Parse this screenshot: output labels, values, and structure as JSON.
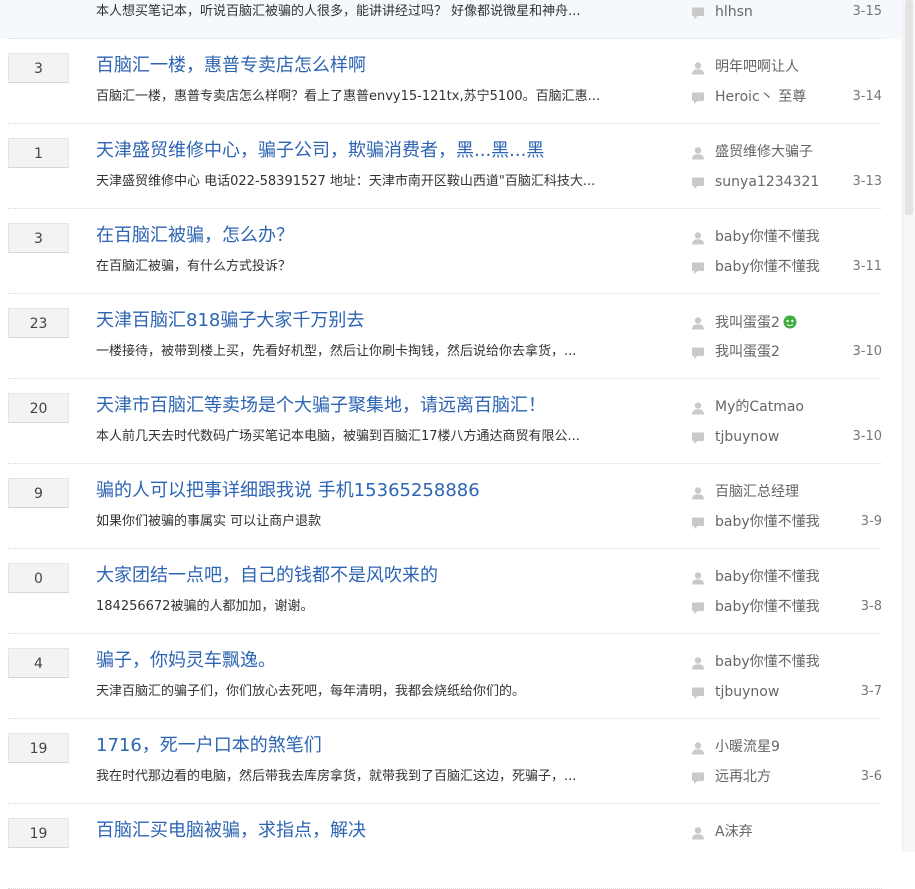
{
  "threads": [
    {
      "replies": "",
      "title": "",
      "excerpt": "本人想买笔记本，听说百脑汇被骗的人很多，能讲讲经过吗？ 好像都说微星和神舟...",
      "author": "",
      "last_replier": "hlhsn",
      "date": "3-15"
    },
    {
      "replies": "3",
      "title": "百脑汇一楼，惠普专卖店怎么样啊",
      "excerpt": "百脑汇一楼，惠普专卖店怎么样啊？看上了惠普envy15-121tx,苏宁5100。百脑汇惠...",
      "author": "明年吧啊让人",
      "last_replier": "Heroic丶 至尊",
      "date": "3-14"
    },
    {
      "replies": "1",
      "title": "天津盛贸维修中心，骗子公司，欺骗消费者，黑...黑...黑",
      "excerpt": "天津盛贸维修中心 电话022-58391527 地址：天津市南开区鞍山西道\"百脑汇科技大...",
      "author": "盛贸维修大骗子",
      "last_replier": "sunya1234321",
      "date": "3-13"
    },
    {
      "replies": "3",
      "title": "在百脑汇被骗，怎么办？",
      "excerpt": "在百脑汇被骗，有什么方式投诉？",
      "author": "baby你懂不懂我",
      "last_replier": "baby你懂不懂我",
      "date": "3-11"
    },
    {
      "replies": "23",
      "title": "天津百脑汇818骗子大家千万别去",
      "excerpt": "一楼接待，被带到楼上买，先看好机型，然后让你刷卡掏钱，然后说给你去拿货，...",
      "author": "我叫蛋蛋2",
      "author_badge": "green-face-icon",
      "last_replier": "我叫蛋蛋2",
      "date": "3-10"
    },
    {
      "replies": "20",
      "title": "天津市百脑汇等卖场是个大骗子聚集地，请远离百脑汇！",
      "excerpt": "本人前几天去时代数码广场买笔记本电脑，被骗到百脑汇17楼八方通达商贸有限公...",
      "author": "My的Catmao",
      "last_replier": "tjbuynow",
      "date": "3-10"
    },
    {
      "replies": "9",
      "title": "骗的人可以把事详细跟我说 手机15365258886",
      "excerpt": "如果你们被骗的事属实 可以让商户退款",
      "author": "百脑汇总经理",
      "last_replier": "baby你懂不懂我",
      "date": "3-9"
    },
    {
      "replies": "0",
      "title": "大家团结一点吧，自己的钱都不是风吹来的",
      "excerpt": "184256672被骗的人都加加，谢谢。",
      "author": "baby你懂不懂我",
      "last_replier": "baby你懂不懂我",
      "date": "3-8"
    },
    {
      "replies": "4",
      "title": "骗子，你妈灵车飘逸。",
      "excerpt": "天津百脑汇的骗子们，你们放心去死吧，每年清明，我都会烧纸给你们的。",
      "author": "baby你懂不懂我",
      "last_replier": "tjbuynow",
      "date": "3-7"
    },
    {
      "replies": "19",
      "title": "1716，死一户口本的煞笔们",
      "excerpt": "我在时代那边看的电脑，然后带我去库房拿货，就带我到了百脑汇这边，死骗子，...",
      "author": "小暖流星9",
      "last_replier": "远再北方",
      "date": "3-6"
    },
    {
      "replies": "19",
      "title": "百脑汇买电脑被骗，求指点，解决",
      "excerpt": "",
      "author": "A沫弃",
      "last_replier": "",
      "date": ""
    }
  ],
  "colors": {
    "title_link": "#2d64b3",
    "count_box_bg": "#f3f3f3",
    "first_row_bg": "#f5f8fd",
    "icon_gray": "#c9c9c9",
    "badge_green": "#3fae3f"
  },
  "icons": {
    "author": "user-silhouette-icon",
    "last_reply": "speech-bubble-icon"
  }
}
